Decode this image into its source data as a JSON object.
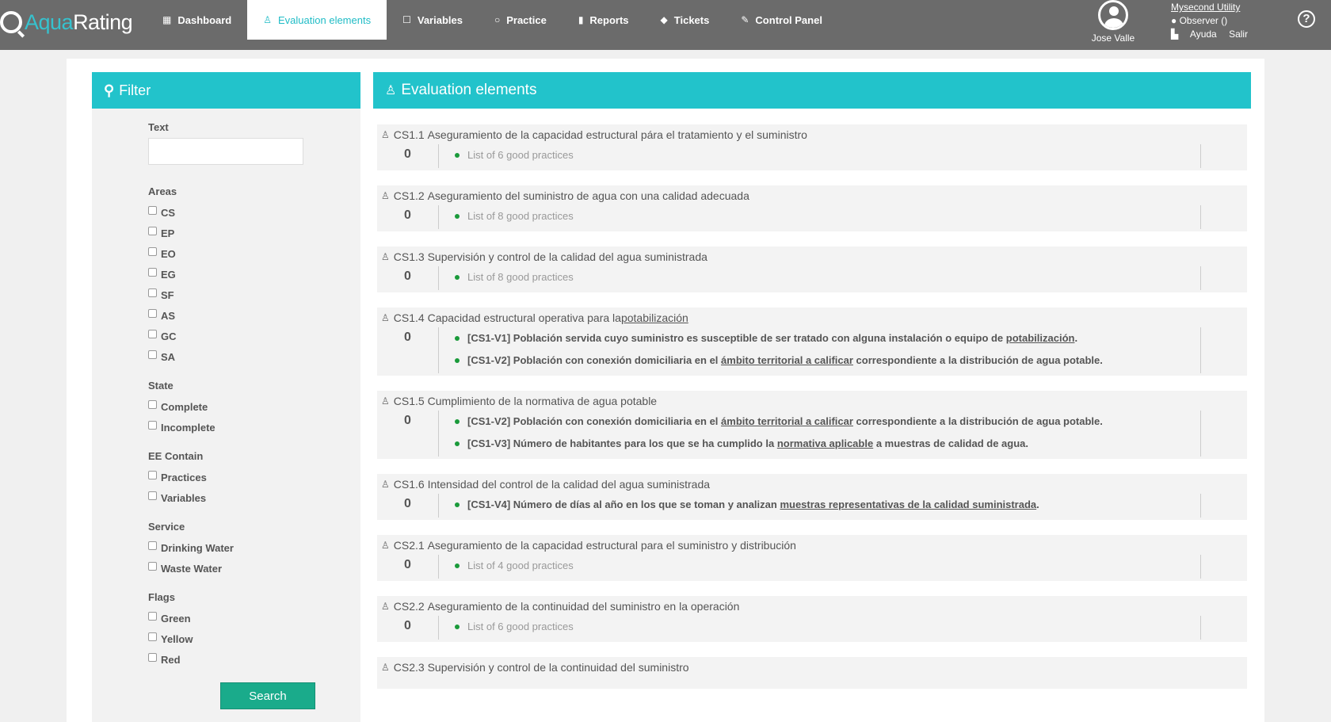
{
  "logo": {
    "part1": "Aqua",
    "part2": "Rating"
  },
  "nav": [
    {
      "icon": "▦",
      "label": "Dashboard",
      "active": false
    },
    {
      "icon": "♙",
      "label": "Evaluation elements",
      "active": true
    },
    {
      "icon": "☐",
      "label": "Variables",
      "active": false
    },
    {
      "icon": "○",
      "label": "Practice",
      "active": false
    },
    {
      "icon": "▮",
      "label": "Reports",
      "active": false
    },
    {
      "icon": "◆",
      "label": "Tickets",
      "active": false
    },
    {
      "icon": "✎",
      "label": "Control Panel",
      "active": false
    }
  ],
  "user": {
    "name": "Jose Valle"
  },
  "org": {
    "name": "Mysecond Utility",
    "role": "● Observer ()",
    "help_link": "Ayuda",
    "logout_link": "Salir"
  },
  "help_icon": "?",
  "filter": {
    "title": "Filter",
    "text_label": "Text",
    "text_value": "",
    "groups": [
      {
        "label": "Areas",
        "options": [
          "CS",
          "EP",
          "EO",
          "EG",
          "SF",
          "AS",
          "GC",
          "SA"
        ]
      },
      {
        "label": "State",
        "options": [
          "Complete",
          "Incomplete"
        ]
      },
      {
        "label": "EE Contain",
        "options": [
          "Practices",
          "Variables"
        ]
      },
      {
        "label": "Service",
        "options": [
          "Drinking Water",
          "Waste Water"
        ]
      },
      {
        "label": "Flags",
        "options": [
          "Green",
          "Yellow",
          "Red"
        ]
      }
    ],
    "search_label": "Search"
  },
  "main": {
    "title": "Evaluation elements",
    "elements": [
      {
        "code": "CS1.1",
        "title": "Aseguramiento de la capacidad estructural pára el tratamiento y el suministro",
        "title_link": "",
        "score": "0",
        "items": [
          {
            "type": "gp",
            "text": "List of 6 good practices"
          }
        ]
      },
      {
        "code": "CS1.2",
        "title": "Aseguramiento del suministro de agua con una calidad adecuada",
        "title_link": "",
        "score": "0",
        "items": [
          {
            "type": "gp",
            "text": "List of 8 good practices"
          }
        ]
      },
      {
        "code": "CS1.3",
        "title": "Supervisión y control de la calidad del agua suministrada",
        "title_link": "",
        "score": "0",
        "items": [
          {
            "type": "gp",
            "text": "List of 8 good practices"
          }
        ]
      },
      {
        "code": "CS1.4",
        "title": "Capacidad estructural operativa para la ",
        "title_link": "potabilización",
        "score": "0",
        "items": [
          {
            "type": "var",
            "pre": "[CS1-V1] Población servida cuyo suministro es susceptible de ser tratado con alguna instalación o equipo de ",
            "link": "potabilización",
            "post": "."
          },
          {
            "type": "var",
            "pre": "[CS1-V2] Población con conexión domiciliaria en el ",
            "link": "ámbito territorial a calificar",
            "post": " correspondiente a la distribución de agua potable."
          }
        ]
      },
      {
        "code": "CS1.5",
        "title": "Cumplimiento de la normativa de agua potable",
        "title_link": "",
        "score": "0",
        "items": [
          {
            "type": "var",
            "pre": "[CS1-V2] Población con conexión domiciliaria en el ",
            "link": "ámbito territorial a calificar",
            "post": " correspondiente a la distribución de agua potable."
          },
          {
            "type": "var",
            "pre": "[CS1-V3] Número de habitantes para los que se ha cumplido la ",
            "link": "normativa aplicable",
            "post": " a muestras de calidad de agua."
          }
        ]
      },
      {
        "code": "CS1.6",
        "title": "Intensidad del control de la calidad del agua suministrada",
        "title_link": "",
        "score": "0",
        "items": [
          {
            "type": "var",
            "pre": "[CS1-V4] Número de días al año en los que se toman y analizan ",
            "link": "muestras representativas de la calidad suministrada",
            "post": "."
          }
        ]
      },
      {
        "code": "CS2.1",
        "title": "Aseguramiento de la capacidad estructural para el suministro y distribución",
        "title_link": "",
        "score": "0",
        "items": [
          {
            "type": "gp",
            "text": "List of 4 good practices"
          }
        ]
      },
      {
        "code": "CS2.2",
        "title": "Aseguramiento de la continuidad del suministro en la operación",
        "title_link": "",
        "score": "0",
        "items": [
          {
            "type": "gp",
            "text": "List of 6 good practices"
          }
        ]
      },
      {
        "code": "CS2.3",
        "title": "Supervisión y control de la continuidad del suministro",
        "title_link": "",
        "score": "0",
        "items": []
      }
    ]
  }
}
